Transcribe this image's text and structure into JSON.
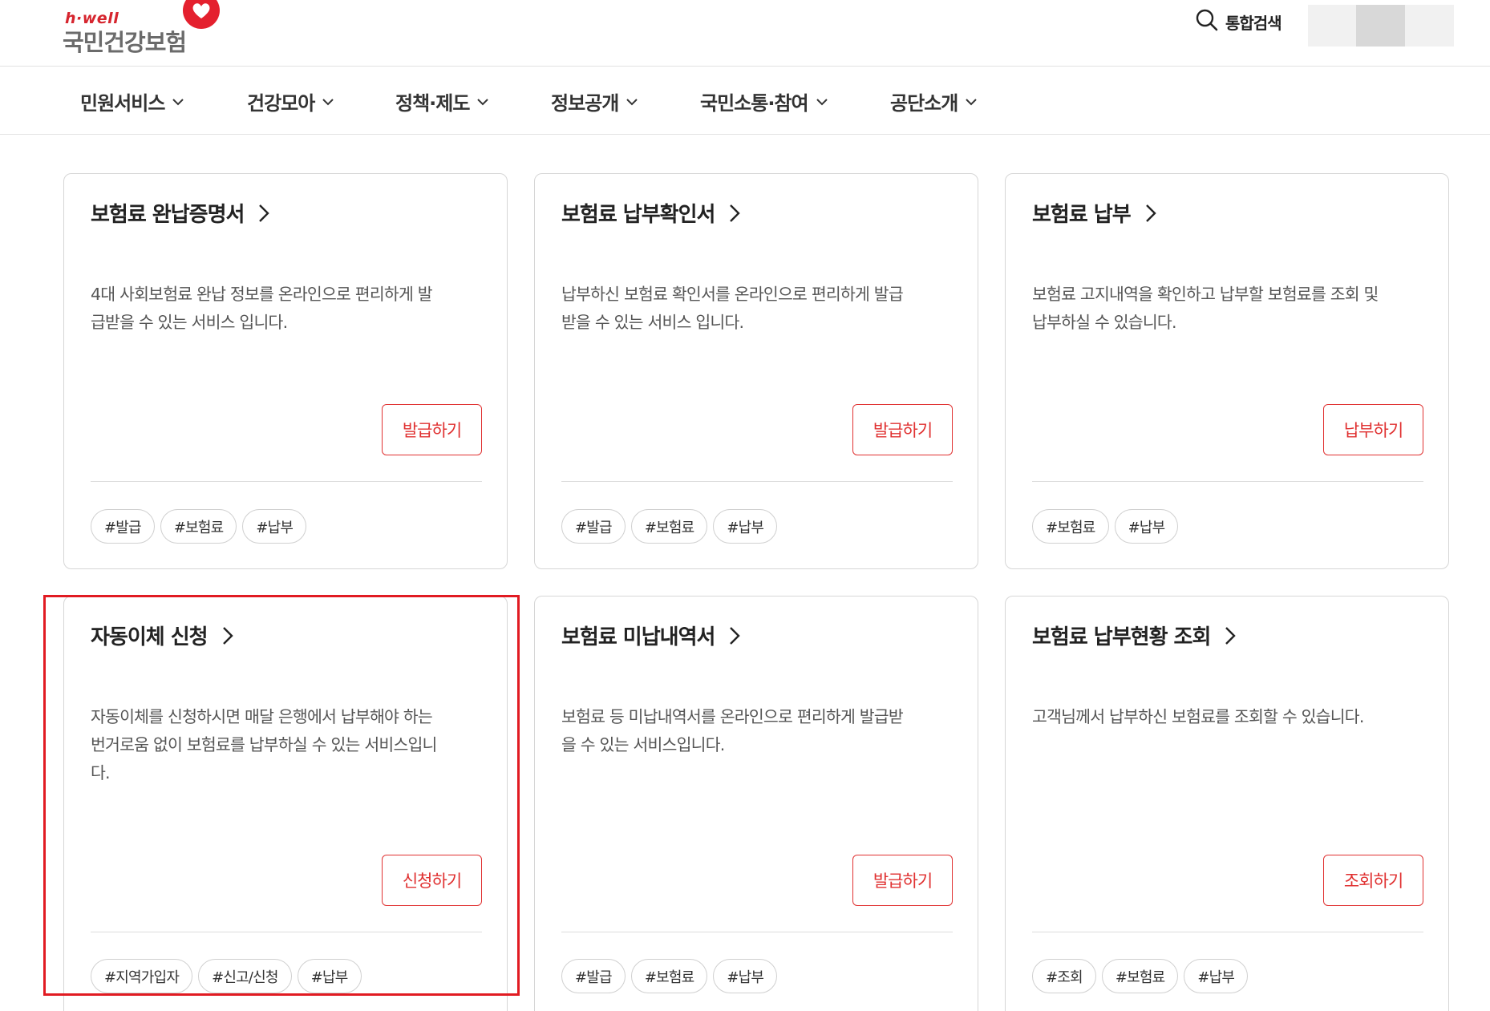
{
  "header": {
    "logo_small": "h·well",
    "logo_main": "국민건강보험",
    "search_label": "통합검색"
  },
  "nav": {
    "items": [
      {
        "label": "민원서비스"
      },
      {
        "label": "건강모아"
      },
      {
        "label": "정책·제도"
      },
      {
        "label": "정보공개"
      },
      {
        "label": "국민소통·참여"
      },
      {
        "label": "공단소개"
      }
    ]
  },
  "cards": [
    {
      "title": "보험료 완납증명서",
      "desc_lines": [
        "4대 사회보험료 완납 정보를 온라인으로 편리하게 발",
        "급받을 수 있는 서비스 입니다."
      ],
      "button": "발급하기",
      "tags": [
        "#발급",
        "#보험료",
        "#납부"
      ]
    },
    {
      "title": "보험료 납부확인서",
      "desc_lines": [
        "납부하신 보험료 확인서를 온라인으로 편리하게 발급",
        "받을 수 있는 서비스 입니다."
      ],
      "button": "발급하기",
      "tags": [
        "#발급",
        "#보험료",
        "#납부"
      ]
    },
    {
      "title": "보험료 납부",
      "desc_lines": [
        "보험료 고지내역을 확인하고 납부할 보험료를 조회 및",
        "납부하실 수 있습니다."
      ],
      "button": "납부하기",
      "tags": [
        "#보험료",
        "#납부"
      ]
    },
    {
      "title": "자동이체 신청",
      "desc_lines": [
        "자동이체를 신청하시면 매달 은행에서 납부해야 하는",
        "번거로움 없이 보험료를 납부하실 수 있는 서비스입니",
        "다."
      ],
      "button": "신청하기",
      "tags": [
        "#지역가입자",
        "#신고/신청",
        "#납부"
      ]
    },
    {
      "title": "보험료 미납내역서",
      "desc_lines": [
        "보험료 등 미납내역서를 온라인으로 편리하게 발급받",
        "을 수 있는 서비스입니다."
      ],
      "button": "발급하기",
      "tags": [
        "#발급",
        "#보험료",
        "#납부"
      ]
    },
    {
      "title": "보험료 납부현황 조회",
      "desc_lines": [
        "고객님께서 납부하신 보험료를 조회할 수 있습니다."
      ],
      "button": "조회하기",
      "tags": [
        "#조회",
        "#보험료",
        "#납부"
      ]
    }
  ],
  "colors": {
    "accent": "#e03131",
    "highlight": "#e11b22"
  }
}
